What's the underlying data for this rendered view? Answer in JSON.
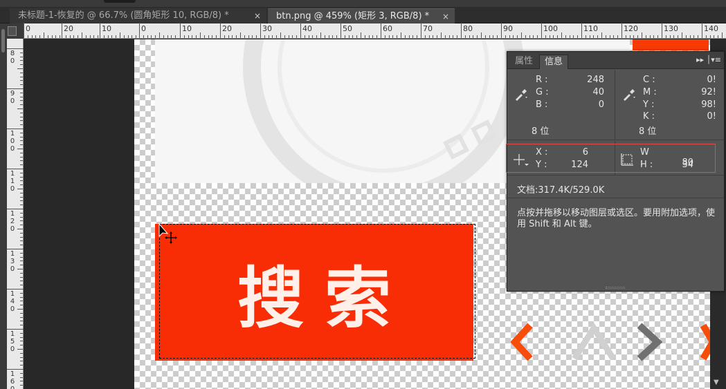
{
  "tabs": [
    {
      "label": "未标题-1-恢复的 @ 66.7% (圆角矩形 10, RGB/8) *",
      "close": "×"
    },
    {
      "label": "btn.png @ 459% (矩形 3, RGB/8) *",
      "close": "×"
    }
  ],
  "ruler_h": [
    "0",
    "20",
    "10",
    "0",
    "10",
    "20",
    "30",
    "40",
    "50",
    "60",
    "70",
    "80",
    "90",
    "100",
    "110",
    "120",
    "130",
    "140"
  ],
  "ruler_v": [
    "8\n0",
    "9\n0",
    "1\n0\n0",
    "1\n1\n0",
    "1\n2\n0",
    "1\n3\n0",
    "1\n4\n0",
    "1\n5\n0",
    "1\n6\n0"
  ],
  "canvas": {
    "button_text": "搜索",
    "button_color": "#f82c05"
  },
  "panel": {
    "tab_properties": "属性",
    "tab_info": "信息",
    "rgb": [
      {
        "k": "R :",
        "v": "248"
      },
      {
        "k": "G :",
        "v": "40"
      },
      {
        "k": "B :",
        "v": "0"
      }
    ],
    "cmyk": [
      {
        "k": "C :",
        "v": "0!"
      },
      {
        "k": "M :",
        "v": "92!"
      },
      {
        "k": "Y :",
        "v": "98!"
      },
      {
        "k": "K :",
        "v": "0!"
      }
    ],
    "bits_left": "8 位",
    "bits_right": "8 位",
    "x": {
      "k": "X :",
      "v": "6"
    },
    "y": {
      "k": "Y :",
      "v": "124"
    },
    "w": {
      "k": "W :",
      "v": "80"
    },
    "h": {
      "k": "H :",
      "v": "34"
    },
    "doc_info": "文档:317.4K/529.0K",
    "hint": "点按并拖移以移动图层或选区。要用附加选项，使用 Shift 和 Alt 键。"
  },
  "colors": {
    "accent": "#f82c05",
    "highlight": "#e24b47",
    "arrow_orange": "#f84c0a",
    "arrow_gray": "#d0d0d0",
    "arrow_dark": "#707070"
  }
}
